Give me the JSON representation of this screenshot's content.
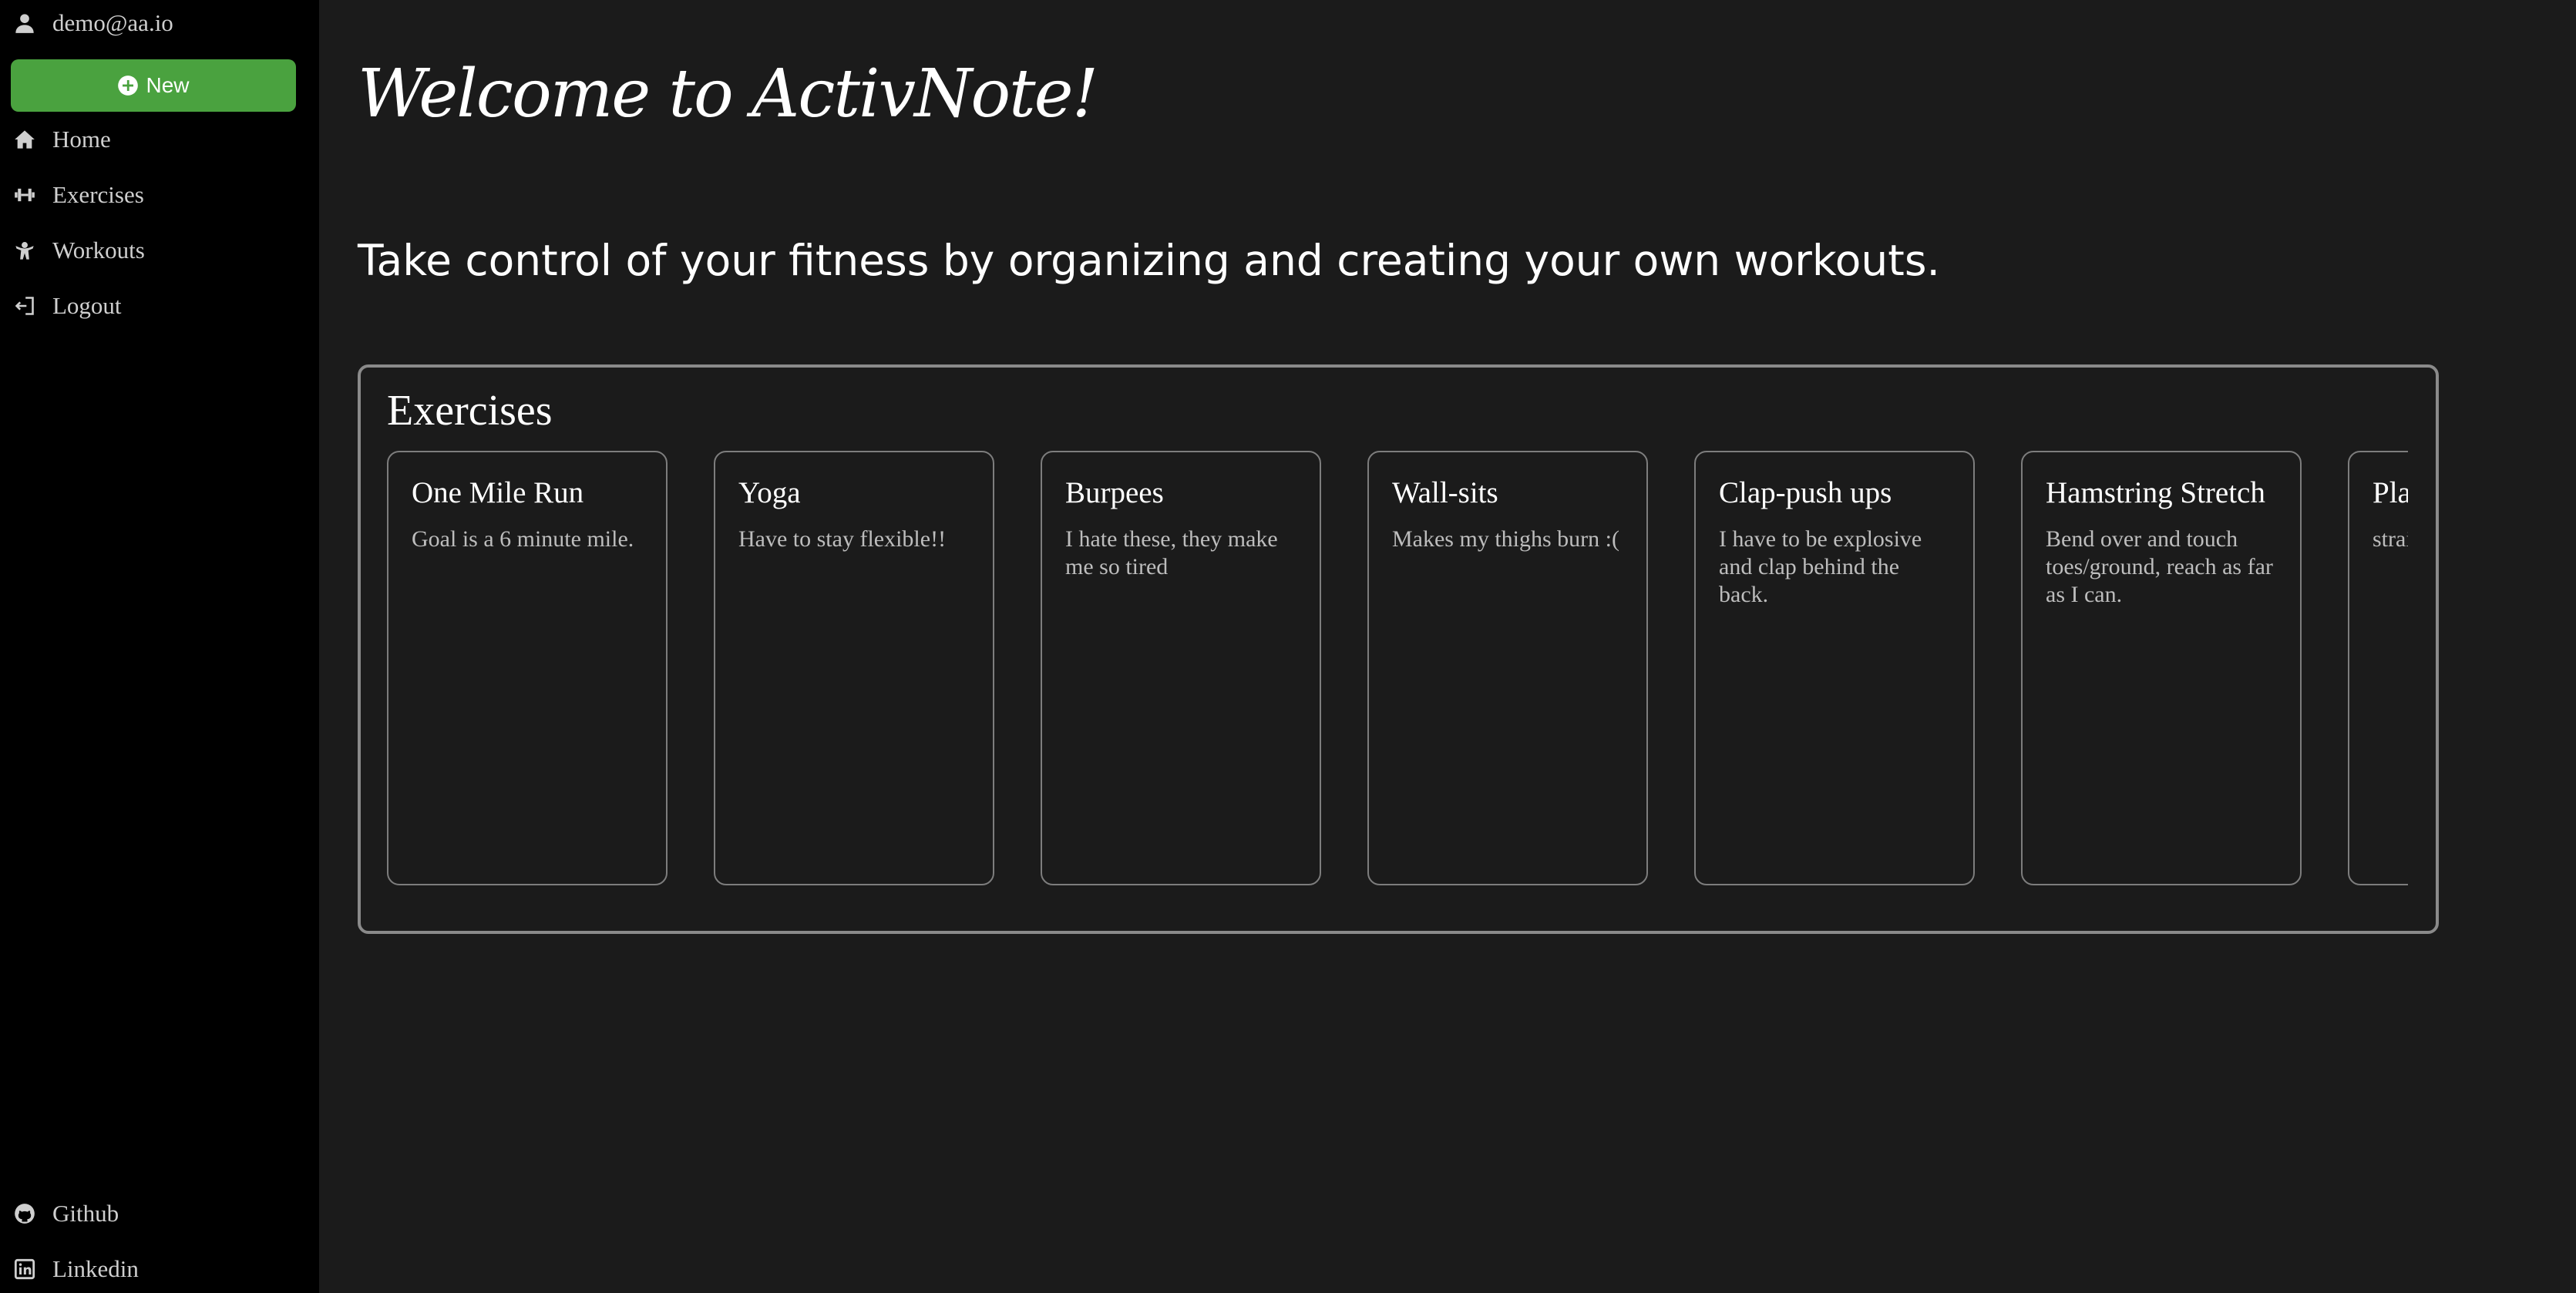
{
  "sidebar": {
    "user_email": "demo@aa.io",
    "new_button_label": "New",
    "nav": [
      {
        "label": "Home",
        "icon": "home-icon"
      },
      {
        "label": "Exercises",
        "icon": "dumbbell-icon"
      },
      {
        "label": "Workouts",
        "icon": "workout-icon"
      },
      {
        "label": "Logout",
        "icon": "logout-icon"
      }
    ],
    "footer_links": [
      {
        "label": "Github",
        "icon": "github-icon"
      },
      {
        "label": "Linkedin",
        "icon": "linkedin-icon"
      }
    ]
  },
  "main": {
    "title": "Welcome to ActivNote!",
    "subtitle": "Take control of your fitness by organizing and creating your own workouts.",
    "exercises": {
      "heading": "Exercises",
      "cards": [
        {
          "title": "One Mile Run",
          "description": "Goal is a 6 minute mile."
        },
        {
          "title": "Yoga",
          "description": "Have to stay flexible!!"
        },
        {
          "title": "Burpees",
          "description": "I hate these, they make me so tired"
        },
        {
          "title": "Wall-sits",
          "description": "Makes my thighs burn :("
        },
        {
          "title": "Clap-push ups",
          "description": "I have to be explosive and clap behind the back."
        },
        {
          "title": "Hamstring Stretch",
          "description": "Bend over and touch toes/ground, reach as far as I can."
        },
        {
          "title": "Plank",
          "description": "straigh"
        }
      ]
    }
  },
  "colors": {
    "sidebar_bg": "#000000",
    "main_bg": "#1b1b1b",
    "accent_green": "#4aa23f",
    "nav_text": "#cfcfcf"
  }
}
